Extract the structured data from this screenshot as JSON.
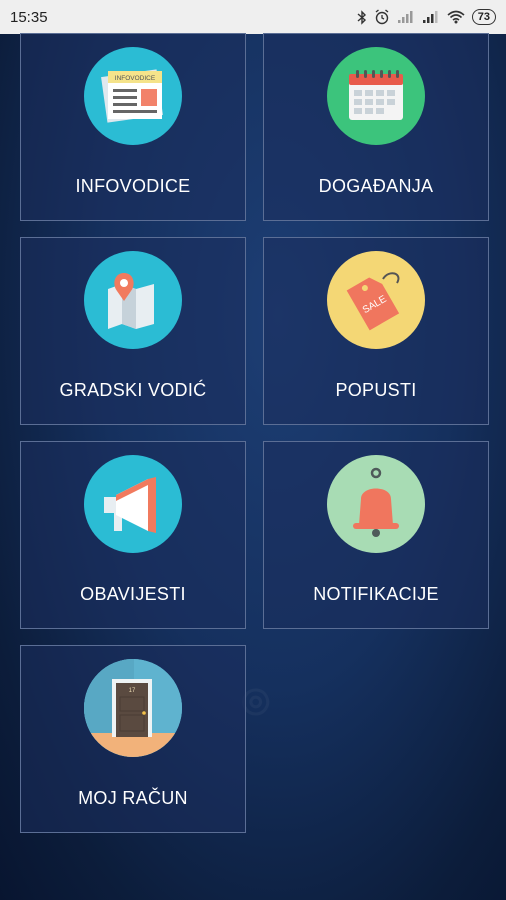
{
  "status_bar": {
    "time": "15:35",
    "battery_level": "73",
    "icons": [
      "bluetooth-icon",
      "alarm-icon",
      "signal-icon",
      "signal-icon",
      "wifi-icon",
      "battery-icon"
    ]
  },
  "menu": {
    "tiles": [
      {
        "label": "INFOVODICE",
        "icon": "newspaper-icon",
        "circle_color": "#2bbcd4"
      },
      {
        "label": "DOGAĐANJA",
        "icon": "calendar-icon",
        "circle_color": "#3cc47c"
      },
      {
        "label": "GRADSKI VODIĆ",
        "icon": "map-pin-icon",
        "circle_color": "#2bbcd4"
      },
      {
        "label": "POPUSTI",
        "icon": "sale-tag-icon",
        "circle_color": "#f4d775"
      },
      {
        "label": "OBAVIJESTI",
        "icon": "megaphone-icon",
        "circle_color": "#2bbcd4"
      },
      {
        "label": "NOTIFIKACIJE",
        "icon": "bell-icon",
        "circle_color": "#a8dcb4"
      },
      {
        "label": "MOJ RAČUN",
        "icon": "door-icon",
        "circle_color": "#5fb3cf"
      }
    ],
    "infovodice_icon_text": "INFOVODICE",
    "sale_tag_text": "SALE",
    "door_number": "17"
  }
}
